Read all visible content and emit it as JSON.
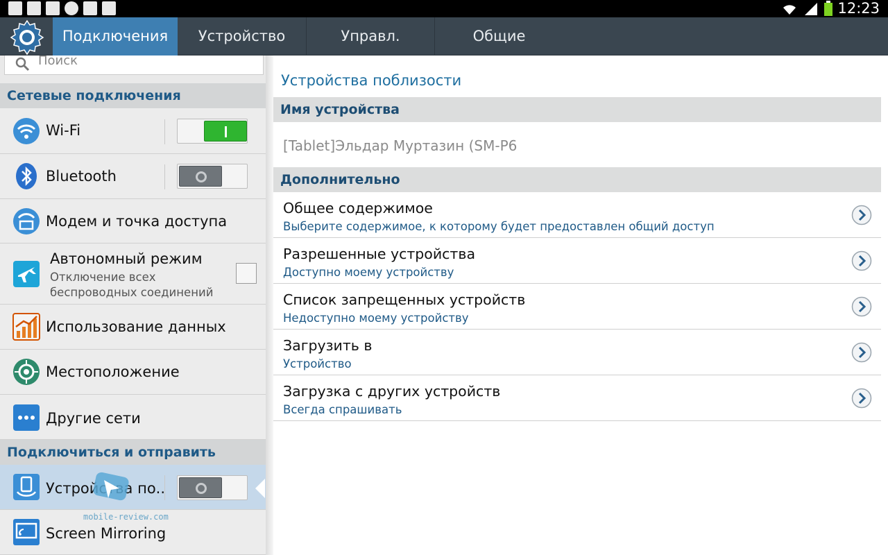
{
  "status_bar": {
    "time": "12:23",
    "battery_color": "#7ed321"
  },
  "tabs": [
    {
      "label": "Подключения",
      "active": true
    },
    {
      "label": "Устройство",
      "active": false
    },
    {
      "label": "Управл.",
      "active": false
    },
    {
      "label": "Общие",
      "active": false
    }
  ],
  "left": {
    "search_placeholder": "Поиск",
    "section_network": "Сетевые подключения",
    "items": {
      "wifi": {
        "label": "Wi-Fi",
        "switch": "on"
      },
      "bluetooth": {
        "label": "Bluetooth",
        "switch": "off"
      },
      "tethering": {
        "label": "Модем и точка доступа"
      },
      "airplane": {
        "label": "Автономный режим",
        "sub1": "Отключение всех",
        "sub2": "беспроводных соединений",
        "checked": false
      },
      "data_usage": {
        "label": "Использование данных"
      },
      "location": {
        "label": "Местоположение"
      },
      "more_networks": {
        "label": "Другие сети"
      },
      "nearby": {
        "label": "Устройства по..",
        "switch": "off"
      },
      "mirroring": {
        "label": "Screen Mirroring"
      }
    },
    "section_connect": "Подключиться и отправить",
    "watermark": "mobile-review.com"
  },
  "right": {
    "title": "Устройства поблизости",
    "section_device_name": "Имя устройства",
    "device_name": "[Tablet]Эльдар Муртазин (SM-P6",
    "section_advanced": "Дополнительно",
    "items": [
      {
        "title": "Общее содержимое",
        "subtitle": "Выберите содержимое, к которому будет предоставлен общий доступ"
      },
      {
        "title": "Разрешенные устройства",
        "subtitle": "Доступно моему устройству"
      },
      {
        "title": "Список запрещенных устройств",
        "subtitle": "Недоступно моему устройству"
      },
      {
        "title": "Загрузить в",
        "subtitle": "Устройство"
      },
      {
        "title": "Загрузка с других устройств",
        "subtitle": "Всегда спрашивать"
      }
    ]
  },
  "colors": {
    "accent": "#3e7fb2",
    "section_text": "#1f5a87",
    "switch_on": "#2fb530"
  }
}
